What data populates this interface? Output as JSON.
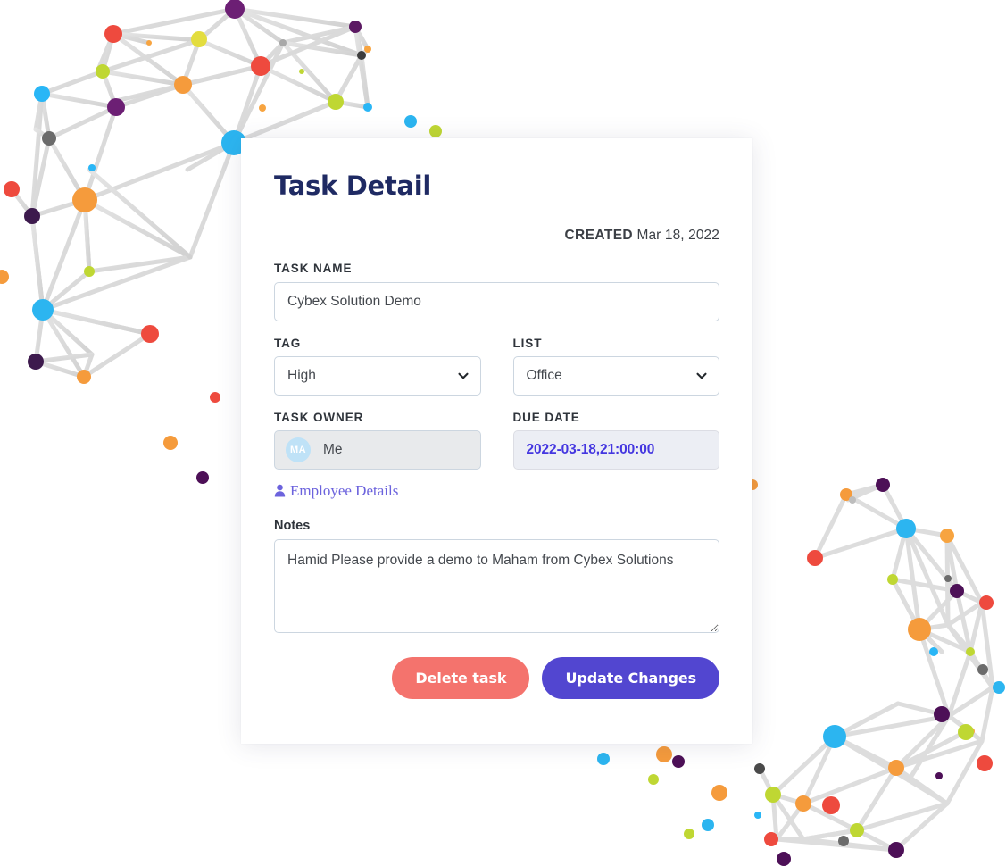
{
  "card": {
    "title": "Task Detail",
    "created": {
      "label": "CREATED",
      "value": "Mar 18, 2022"
    },
    "fields": {
      "task_name": {
        "label": "TASK NAME",
        "value": "Cybex Solution Demo",
        "placeholder": "Task name"
      },
      "tag": {
        "label": "TAG",
        "value": "High",
        "options": [
          "High"
        ]
      },
      "list": {
        "label": "LIST",
        "value": "Office",
        "options": [
          "Office"
        ]
      },
      "task_owner": {
        "label": "TASK OWNER",
        "avatar_initials": "MA",
        "value": "Me"
      },
      "due_date": {
        "label": "DUE DATE",
        "value": "2022-03-18,21:00:00"
      },
      "notes": {
        "label": "Notes",
        "value": "Hamid Please provide a demo to Maham from Cybex Solutions",
        "placeholder": "Notes"
      }
    },
    "employee_link": {
      "label": "Employee Details",
      "icon": "user-icon"
    },
    "buttons": {
      "delete": "Delete task",
      "update": "Update Changes"
    },
    "icons": {
      "tag_chevron": "chevron-down-icon",
      "list_chevron": "chevron-down-icon"
    }
  },
  "colors": {
    "title": "#1f2a63",
    "delete_button": "#f4736d",
    "update_button": "#5246d0",
    "due_date_text": "#4436e0",
    "link": "#6c63dd",
    "avatar": "#bfe2f7"
  },
  "decoration": {
    "left_network": "network-graph-left",
    "right_network": "network-graph-right",
    "node_palette": [
      "#e8413c",
      "#f59b3c",
      "#bfd733",
      "#7c2d83",
      "#29b6f6",
      "#4a4a4a",
      "#ee4a3e",
      "#f7a440"
    ]
  }
}
